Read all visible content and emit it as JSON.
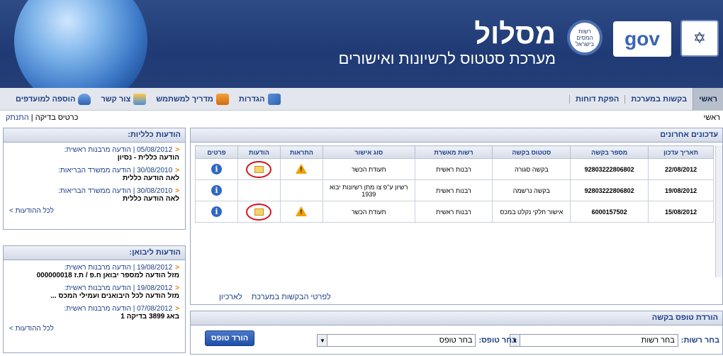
{
  "banner": {
    "title": "מסלול",
    "subtitle": "מערכת סטטוס לרשיונות ואישורים",
    "badge_text": "רשות המסים בישראל",
    "gov_text": "gov",
    "emblem": "menorah-emblem"
  },
  "menu": {
    "right_items": [
      "ראשי",
      "בקשות במערכת",
      "הפקת דוחות"
    ],
    "left_items": [
      {
        "label": "הגדרות",
        "icon": "tools-icon"
      },
      {
        "label": "מדריך למשתמש",
        "icon": "book-icon"
      },
      {
        "label": "צור קשר",
        "icon": "chat-icon"
      },
      {
        "label": "הוספה למועדפים",
        "icon": "heart-icon"
      }
    ]
  },
  "crumbs": {
    "right": "ראשי",
    "left_user": "כרטיס בדיקה",
    "left_logout": "התנתק"
  },
  "updates": {
    "title": "עדכונים אחרונים",
    "columns": [
      "תאריך עדכון",
      "מספר בקשה",
      "סטטוס בקשה",
      "רשות מאשרת",
      "סוג אישור",
      "התראות",
      "הודעות",
      "פרטים"
    ],
    "rows": [
      {
        "date": "22/08/2012",
        "number": "92803222806802",
        "status": "בקשה סגורה",
        "authority": "רבנות ראשית",
        "type": "תעודת הכשר",
        "alert": true,
        "message": true
      },
      {
        "date": "19/08/2012",
        "number": "92803222806802",
        "status": "בקשה נרשמה",
        "authority": "רבנות ראשית",
        "type": "רשיון ע\"פ צו מתן רשיונות יבוא 1939",
        "alert": false,
        "message": false
      },
      {
        "date": "15/08/2012",
        "number": "6000157502",
        "status": "אישור חלקי נקלט במכס",
        "authority": "רבנות ראשית",
        "type": "תעודת הכשר",
        "alert": true,
        "message": true
      }
    ],
    "link_details": "לפרטי הבקשות במערכת",
    "link_archive": "לארכיון"
  },
  "general_news": {
    "title": "הודעות כלליות:",
    "items": [
      {
        "meta": "05/08/2012 | הודעה מרבנות ראשית:",
        "body": "הודעה כללית - נסיון"
      },
      {
        "meta": "30/08/2010 | הודעה ממשרד הבריאות:",
        "body": "לאה הודעה כללית"
      },
      {
        "meta": "30/08/2010 | הודעה ממשרד הבריאות:",
        "body": "לאה הודעה כללית"
      }
    ],
    "more": "לכל ההודעות >"
  },
  "importer_news": {
    "title": "הודעות ליבואן:",
    "items": [
      {
        "meta": "19/08/2012 | הודעה מרבנות ראשית:",
        "body": "מזל הודעה למספר יבואן ח.פ / ת.ז 000000018"
      },
      {
        "meta": "19/08/2012 | הודעה מרבנות ראשית:",
        "body": "מזל הודעה לכל היבואנים ועמילי המכס ..."
      },
      {
        "meta": "07/08/2012 | הודעה מרבנות ראשית:",
        "body": "באג 3899 בדיקה 1"
      }
    ],
    "more": "לכל ההודעות >"
  },
  "download_form": {
    "title": "הורדת טופס בקשה",
    "authority_label": "בחר רשות:",
    "authority_value": "בחר רשות",
    "form_label": "בחר טופס:",
    "form_value": "בחר טופס",
    "button": "הורד טופס"
  }
}
